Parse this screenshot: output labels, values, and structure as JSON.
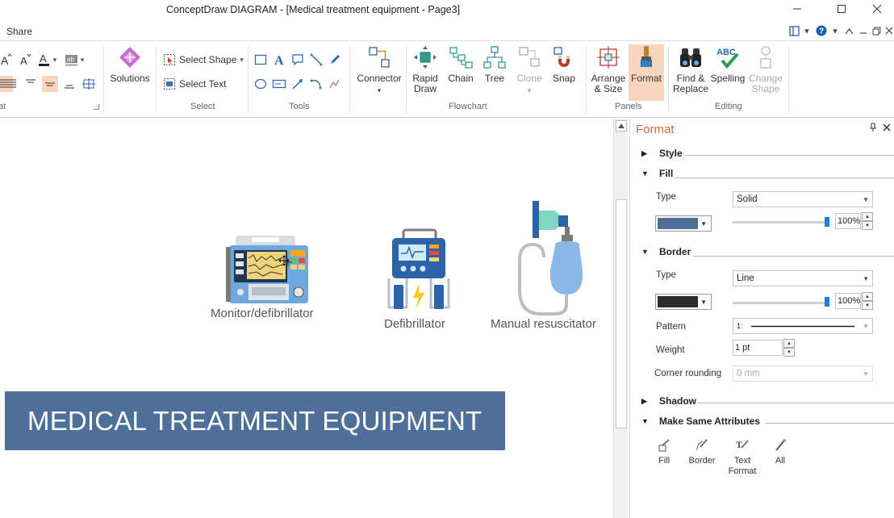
{
  "window": {
    "title": "ConceptDraw DIAGRAM - [Medical treatment equipment - Page3]"
  },
  "menu": {
    "share": "Share"
  },
  "ribbon": {
    "text_group_label": "at",
    "solutions_label": "Solutions",
    "select": {
      "select_shape": "Select Shape",
      "select_text": "Select Text",
      "label": "Select"
    },
    "tools_label": "Tools",
    "connector": "Connector",
    "flowchart": {
      "rapid_draw": "Rapid Draw",
      "chain": "Chain",
      "tree": "Tree",
      "clone": "Clone",
      "snap": "Snap",
      "label": "Flowchart"
    },
    "panels": {
      "arrange_size": "Arrange & Size",
      "format": "Format",
      "label": "Panels"
    },
    "editing": {
      "find_replace": "Find & Replace",
      "spelling": "Spelling",
      "spelling_abc": "ABC",
      "change_shape": "Change Shape",
      "label": "Editing"
    }
  },
  "canvas": {
    "shapes": [
      {
        "label": "Monitor/defibrillator"
      },
      {
        "label": "Defibrillator"
      },
      {
        "label": "Manual resuscitator"
      }
    ],
    "banner_text": "MEDICAL TREATMENT EQUIPMENT",
    "banner_color": "#4e6f9a"
  },
  "format_panel": {
    "title": "Format",
    "style": {
      "header": "Style"
    },
    "fill": {
      "header": "Fill",
      "type_label": "Type",
      "type_value": "Solid",
      "color": "#4e6f9a",
      "opacity": "100%"
    },
    "border": {
      "header": "Border",
      "type_label": "Type",
      "type_value": "Line",
      "color": "#2b2b2b",
      "opacity": "100%",
      "pattern_label": "Pattern",
      "pattern_value": "1:",
      "weight_label": "Weight",
      "weight_value": "1 pt",
      "corner_label": "Corner rounding",
      "corner_value": "0 mm"
    },
    "shadow": {
      "header": "Shadow"
    },
    "make_same": {
      "header": "Make Same Attributes",
      "fill": "Fill",
      "border": "Border",
      "text_format": "Text Format",
      "all": "All"
    }
  }
}
